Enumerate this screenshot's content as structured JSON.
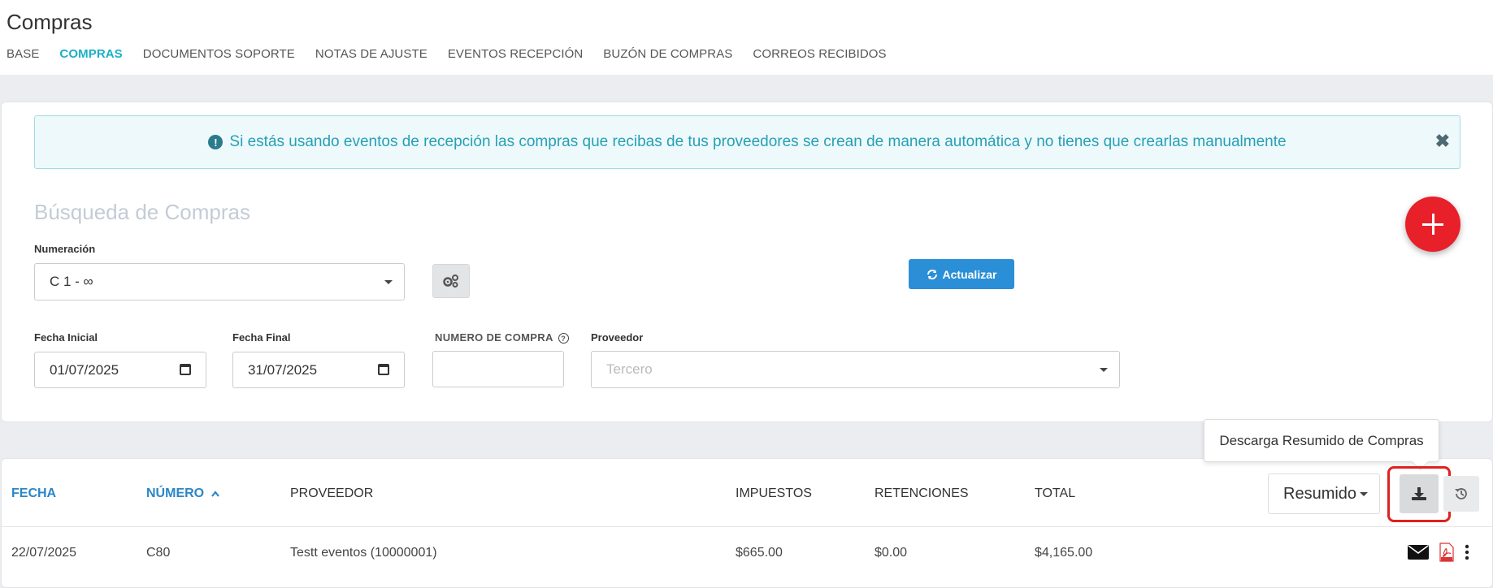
{
  "header": {
    "title": "Compras",
    "tabs": [
      {
        "label": "BASE"
      },
      {
        "label": "COMPRAS"
      },
      {
        "label": "DOCUMENTOS SOPORTE"
      },
      {
        "label": "NOTAS DE AJUSTE"
      },
      {
        "label": "EVENTOS RECEPCIÓN"
      },
      {
        "label": "BUZÓN DE COMPRAS"
      },
      {
        "label": "CORREOS RECIBIDOS"
      }
    ],
    "active_tab": "COMPRAS",
    "accent_color": "#1ab0c6"
  },
  "alert": {
    "message": "Si estás usando eventos de recepción las compras que recibas de tus proveedores se crean de manera automática y no tienes que crearlas manualmente",
    "close_label": "✖"
  },
  "search": {
    "title": "Búsqueda de Compras",
    "numeracion_label": "Numeración",
    "numeracion_value": "C 1 - ∞",
    "refresh_label": "Actualizar",
    "fecha_inicial_label": "Fecha Inicial",
    "fecha_inicial_value": "01/07/2025",
    "fecha_final_label": "Fecha Final",
    "fecha_final_value": "31/07/2025",
    "numero_label": "NUMERO DE COMPRA",
    "numero_value": "",
    "proveedor_label": "Proveedor",
    "proveedor_placeholder": "Tercero"
  },
  "fab": {
    "icon": "plus-icon",
    "color": "#e8202a"
  },
  "table": {
    "columns": [
      "FECHA",
      "NÚMERO",
      "PROVEEDOR",
      "IMPUESTOS",
      "RETENCIONES",
      "TOTAL"
    ],
    "view_select": "Resumido",
    "tooltip": "Descarga Resumido de Compras",
    "rows": [
      {
        "fecha": "22/07/2025",
        "numero": "C80",
        "proveedor": "Testt eventos (10000001)",
        "impuestos": "$665.00",
        "retenciones": "$0.00",
        "total": "$4,165.00"
      }
    ]
  }
}
